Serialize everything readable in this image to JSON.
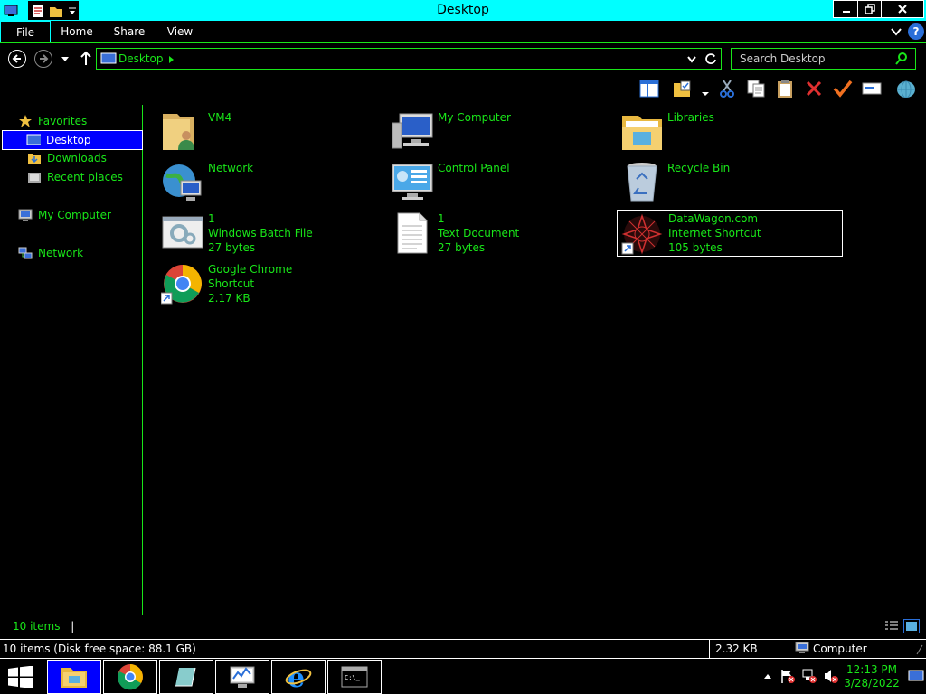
{
  "window": {
    "title": "Desktop"
  },
  "ribbon": {
    "tabs": [
      "File",
      "Home",
      "Share",
      "View"
    ]
  },
  "address": {
    "location": "Desktop"
  },
  "search": {
    "placeholder": "Search Desktop"
  },
  "nav": {
    "favorites": "Favorites",
    "desktop": "Desktop",
    "downloads": "Downloads",
    "recent": "Recent places",
    "computer": "My Computer",
    "network": "Network"
  },
  "items": [
    {
      "lines": [
        "VM4"
      ]
    },
    {
      "lines": [
        "My Computer"
      ]
    },
    {
      "lines": [
        "Libraries"
      ]
    },
    {
      "lines": [
        "Network"
      ]
    },
    {
      "lines": [
        "Control Panel"
      ]
    },
    {
      "lines": [
        "Recycle Bin"
      ]
    },
    {
      "lines": [
        "1",
        "Windows Batch File",
        "27 bytes"
      ]
    },
    {
      "lines": [
        "1",
        "Text Document",
        "27 bytes"
      ]
    },
    {
      "lines": [
        "DataWagon.com",
        "Internet Shortcut",
        "105 bytes"
      ]
    },
    {
      "lines": [
        "Google Chrome",
        "Shortcut",
        "2.17 KB"
      ]
    }
  ],
  "status": {
    "count": "10 items",
    "details": "10 items (Disk free space: 88.1 GB)",
    "size": "2.32 KB",
    "location": "Computer"
  },
  "clock": {
    "time": "12:13 PM",
    "date": "3/28/2022"
  },
  "colors": {
    "text": "#19e619",
    "title_bar": "#00ffff",
    "selection": "#0000ff",
    "background": "#000000"
  }
}
